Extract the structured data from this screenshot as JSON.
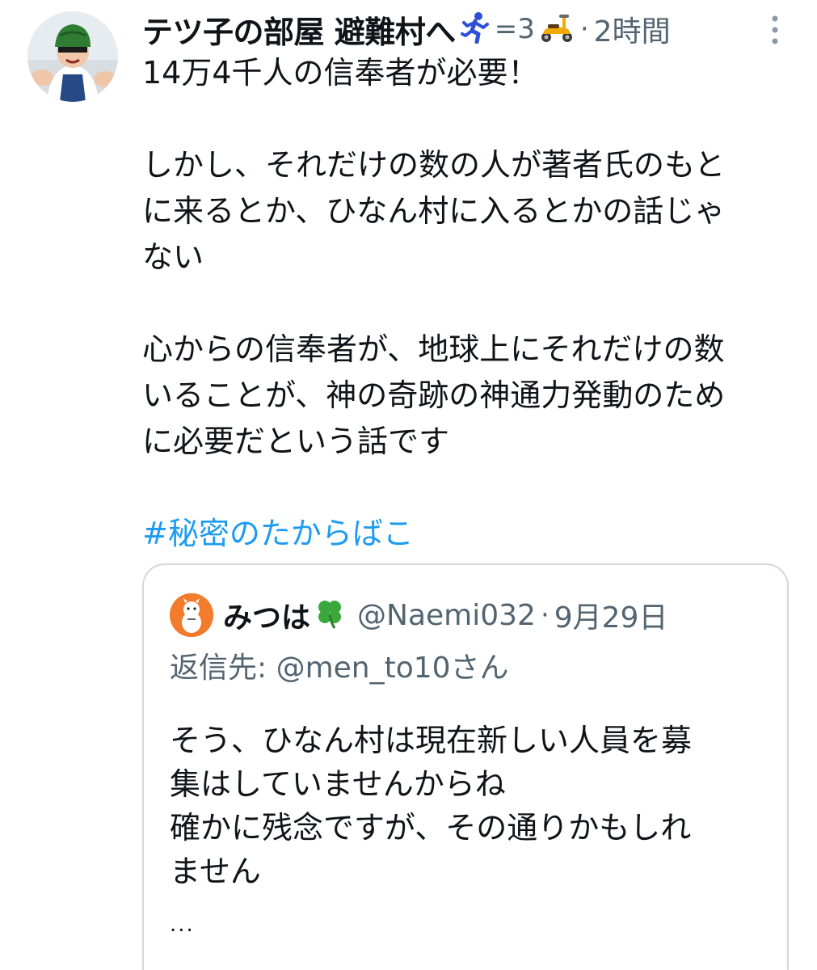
{
  "tweet": {
    "display_name": "テツ子の部屋 避難村へ",
    "name_emojis": {
      "runner": "running-person-emoji",
      "dash_text": "=3",
      "scooter": "scooter-emoji"
    },
    "separator": "·",
    "time": "2時間",
    "body": {
      "line_1": "14万4千人の信奉者が必要！",
      "line_2": "しかし、それだけの数の人が著者氏のもと",
      "line_3": "に来るとか、ひなん村に入るとかの話じゃ",
      "line_4": "ない",
      "line_5": "心からの信奉者が、地球上にそれだけの数",
      "line_6": "いることが、神の奇跡の神通力発動のため",
      "line_7": "に必要だという話です"
    },
    "hashtag": "#秘密のたからばこ",
    "colors": {
      "text": "#0f1419",
      "secondary": "#536471",
      "link": "#1d9bf0",
      "border": "#cfd9de"
    }
  },
  "quote": {
    "display_name": "みつは",
    "name_emoji": "four-leaf-clover-emoji",
    "handle": "@Naemi032",
    "separator": "·",
    "date": "9月29日",
    "reply_to": "返信先: @men_to10さん",
    "text": {
      "line_1": "そう、ひなん村は現在新しい人員を募",
      "line_2": "集はしていませんからね",
      "line_3": "確かに残念ですが、その通りかもしれ",
      "line_4": "ません"
    },
    "ellipsis": "..."
  }
}
